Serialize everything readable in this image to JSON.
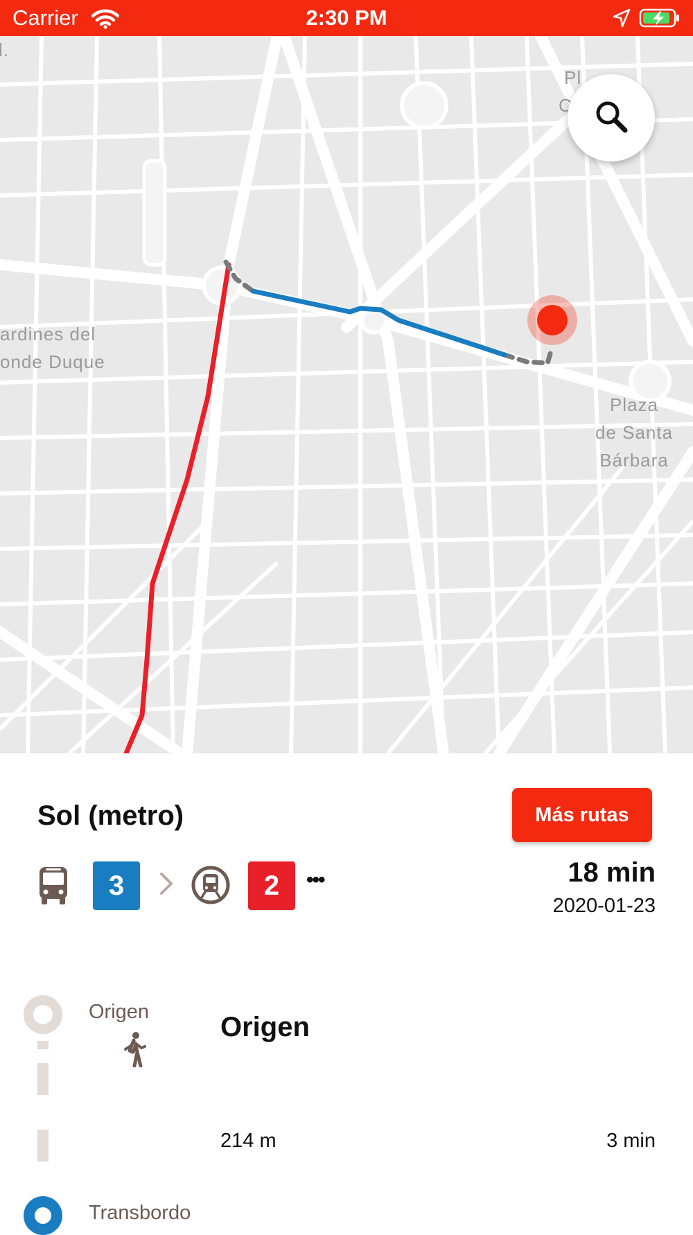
{
  "status_bar": {
    "carrier": "Carrier",
    "time": "2:30 PM",
    "background": "#f32a10"
  },
  "map": {
    "labels": {
      "left_fragment": "l.",
      "top_right_fragment": "Pl",
      "top_right_fragment_2": "C",
      "gardens_line1": "ardines del",
      "gardens_line2": "onde Duque",
      "plaza_line1": "Plaza",
      "plaza_line2": "de Santa",
      "plaza_line3": "Bárbara"
    },
    "route_colors": {
      "metro_line": "#e8202a",
      "bus_line": "#1a7dc1",
      "walk": "#7a7a7a",
      "destination_marker": "#f32a10"
    },
    "search_icon": "search-icon"
  },
  "route": {
    "title": "Sol (metro)",
    "more_routes_label": "Más rutas",
    "legs": [
      {
        "mode": "bus",
        "icon": "bus-icon",
        "line": "3",
        "color": "#1a7dc1"
      },
      {
        "mode": "metro",
        "icon": "metro-icon",
        "line": "2",
        "color": "#e8202a"
      }
    ],
    "more_indicator": "•••",
    "duration": "18 min",
    "date": "2020-01-23"
  },
  "itinerary": {
    "origin_label": "Origen",
    "origin_name": "Origen",
    "walk_icon": "walking-icon",
    "walk_distance": "214 m",
    "walk_time": "3 min",
    "transfer_label": "Transbordo"
  }
}
